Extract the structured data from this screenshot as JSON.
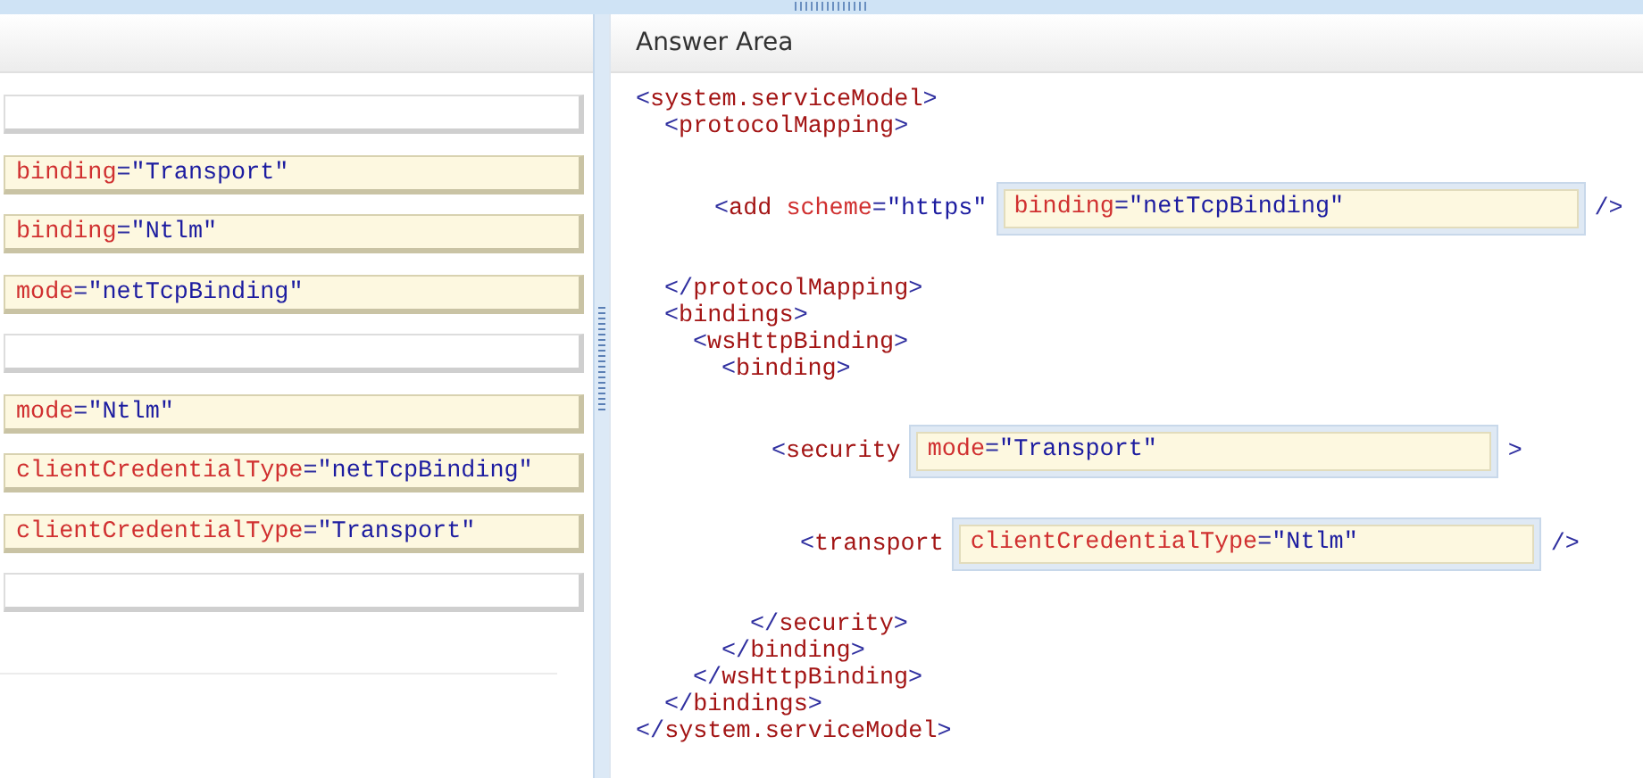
{
  "choices": [
    {
      "kind": "empty"
    },
    {
      "kind": "option",
      "text": "binding=\"Transport\""
    },
    {
      "kind": "option",
      "text": "binding=\"Ntlm\""
    },
    {
      "kind": "option",
      "text": "mode=\"netTcpBinding\""
    },
    {
      "kind": "empty"
    },
    {
      "kind": "option",
      "text": "mode=\"Ntlm\""
    },
    {
      "kind": "option",
      "text": "clientCredentialType=\"netTcpBinding\""
    },
    {
      "kind": "option",
      "text": "clientCredentialType=\"Transport\""
    },
    {
      "kind": "empty"
    }
  ],
  "answer_area": {
    "title": "Answer Area",
    "code": [
      {
        "kind": "element",
        "open": "<system.serviceModel>",
        "close": "</system.serviceModel>",
        "children": [
          {
            "kind": "element",
            "open": "<protocolMapping>",
            "close": "</protocolMapping>",
            "children": [
              {
                "kind": "slot",
                "before": "<add scheme=\"https\"",
                "answer": "binding=\"netTcpBinding\"",
                "after": "/>"
              }
            ]
          },
          {
            "kind": "element",
            "open": "<bindings>",
            "close": "</bindings>",
            "children": [
              {
                "kind": "element",
                "open": "<wsHttpBinding>",
                "close": "</wsHttpBinding>",
                "children": [
                  {
                    "kind": "element",
                    "open": "<binding>",
                    "close": "</binding>",
                    "children": [
                      {
                        "kind": "slot_element",
                        "before": "<security",
                        "answer": "mode=\"Transport\"",
                        "after": ">",
                        "close": "</security>",
                        "children": [
                          {
                            "kind": "slot",
                            "before": "<transport",
                            "answer": "clientCredentialType=\"Ntlm\"",
                            "after": "/>"
                          }
                        ]
                      }
                    ]
                  }
                ]
              }
            ]
          }
        ]
      }
    ]
  }
}
